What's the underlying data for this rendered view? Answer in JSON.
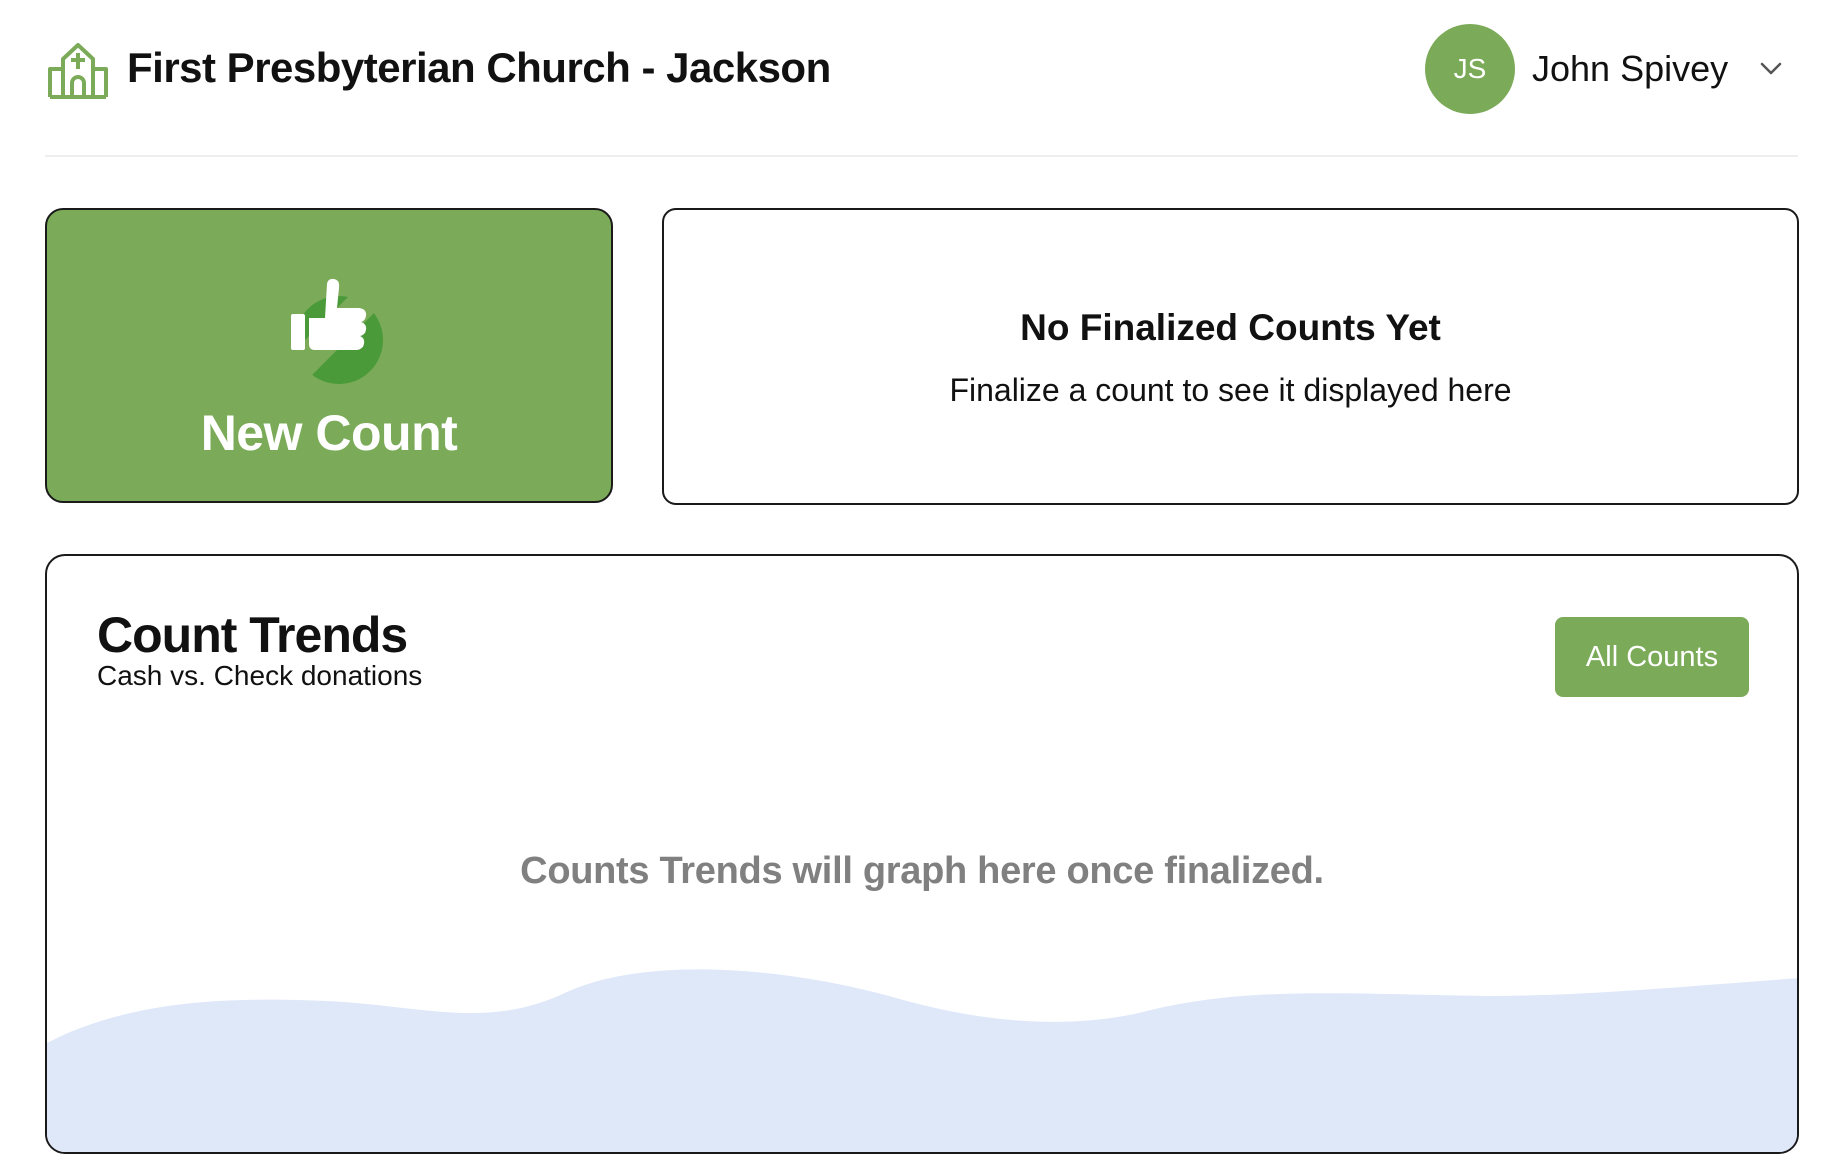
{
  "header": {
    "church_name": "First Presbyterian Church - Jackson",
    "logo_icon": "church-icon",
    "user": {
      "initials": "JS",
      "name": "John Spivey",
      "menu_icon": "chevron-down-icon"
    }
  },
  "new_count": {
    "label": "New Count",
    "icon": "thumbs-up-icon"
  },
  "finalized": {
    "title": "No Finalized Counts Yet",
    "subtitle": "Finalize a count to see it displayed here"
  },
  "trends": {
    "title": "Count Trends",
    "subtitle": "Cash vs. Check donations",
    "all_counts_label": "All Counts",
    "empty_message": "Counts Trends will graph here once finalized."
  },
  "colors": {
    "accent": "#7bab58",
    "accent_dark": "#4a9a3a",
    "wave": "#dfe8f9",
    "muted_text": "#808080"
  }
}
